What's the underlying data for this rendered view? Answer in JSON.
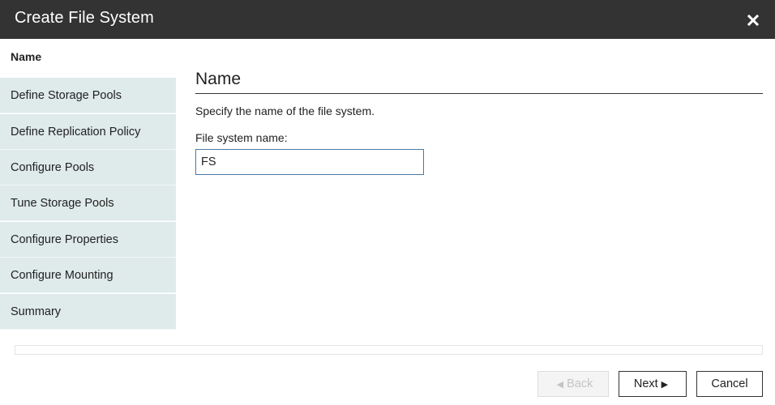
{
  "dialog": {
    "title": "Create File System",
    "close_icon": "close-icon"
  },
  "steps": [
    {
      "label": "Name",
      "active": true
    },
    {
      "label": "Define Storage Pools",
      "active": false
    },
    {
      "label": "Define Replication Policy",
      "active": false
    },
    {
      "label": "Configure Pools",
      "active": false
    },
    {
      "label": "Tune Storage Pools",
      "active": false
    },
    {
      "label": "Configure Properties",
      "active": false
    },
    {
      "label": "Configure Mounting",
      "active": false
    },
    {
      "label": "Summary",
      "active": false
    }
  ],
  "content": {
    "heading": "Name",
    "description": "Specify the name of the file system.",
    "field_label": "File system name:",
    "field_value": "FS"
  },
  "buttons": {
    "back": {
      "label": "Back",
      "icon": "◀",
      "enabled": false
    },
    "next": {
      "label": "Next",
      "icon": "▶",
      "enabled": true
    },
    "cancel": {
      "label": "Cancel",
      "enabled": true
    }
  },
  "colors": {
    "titlebar": "#333333",
    "step_bg": "#dfeaea",
    "field_border": "#4a78a8"
  }
}
